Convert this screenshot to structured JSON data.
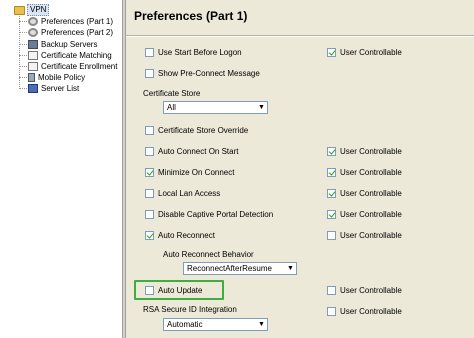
{
  "tree": {
    "root": "VPN",
    "items": [
      {
        "label": "Preferences (Part 1)",
        "icon": "gear-icon"
      },
      {
        "label": "Preferences (Part 2)",
        "icon": "gear-icon"
      },
      {
        "label": "Backup Servers",
        "icon": "server-icon"
      },
      {
        "label": "Certificate Matching",
        "icon": "certificate-icon"
      },
      {
        "label": "Certificate Enrollment",
        "icon": "certificate-icon"
      },
      {
        "label": "Mobile Policy",
        "icon": "mobile-icon"
      },
      {
        "label": "Server List",
        "icon": "list-icon"
      }
    ]
  },
  "panel": {
    "title": "Preferences (Part 1)",
    "options": {
      "use_start_before_logon": {
        "label": "Use Start Before Logon",
        "checked": false,
        "uc_label": "User Controllable",
        "uc_checked": true
      },
      "show_pre_connect": {
        "label": "Show Pre-Connect Message",
        "checked": false
      },
      "cert_store_override": {
        "label": "Certificate Store Override",
        "checked": false
      },
      "auto_connect": {
        "label": "Auto Connect On Start",
        "checked": false,
        "uc_label": "User Controllable",
        "uc_checked": true
      },
      "minimize_on_connect": {
        "label": "Minimize On Connect",
        "checked": true,
        "uc_label": "User Controllable",
        "uc_checked": true
      },
      "local_lan": {
        "label": "Local Lan Access",
        "checked": false,
        "uc_label": "User Controllable",
        "uc_checked": true
      },
      "disable_captive": {
        "label": "Disable Captive Portal Detection",
        "checked": false,
        "uc_label": "User Controllable",
        "uc_checked": true
      },
      "auto_reconnect": {
        "label": "Auto Reconnect",
        "checked": true,
        "uc_label": "User Controllable",
        "uc_checked": false
      },
      "auto_update": {
        "label": "Auto Update",
        "checked": false,
        "uc_label": "User Controllable",
        "uc_checked": false
      }
    },
    "certificate_store": {
      "label": "Certificate Store",
      "value": "All"
    },
    "auto_reconnect_behavior": {
      "label": "Auto Reconnect Behavior",
      "value": "ReconnectAfterResume"
    },
    "rsa_integration": {
      "label": "RSA Secure ID Integration",
      "value": "Automatic",
      "uc_label": "User Controllable",
      "uc_checked": false
    }
  },
  "colors": {
    "highlight": "#3fae3f",
    "check": "#21a121"
  }
}
